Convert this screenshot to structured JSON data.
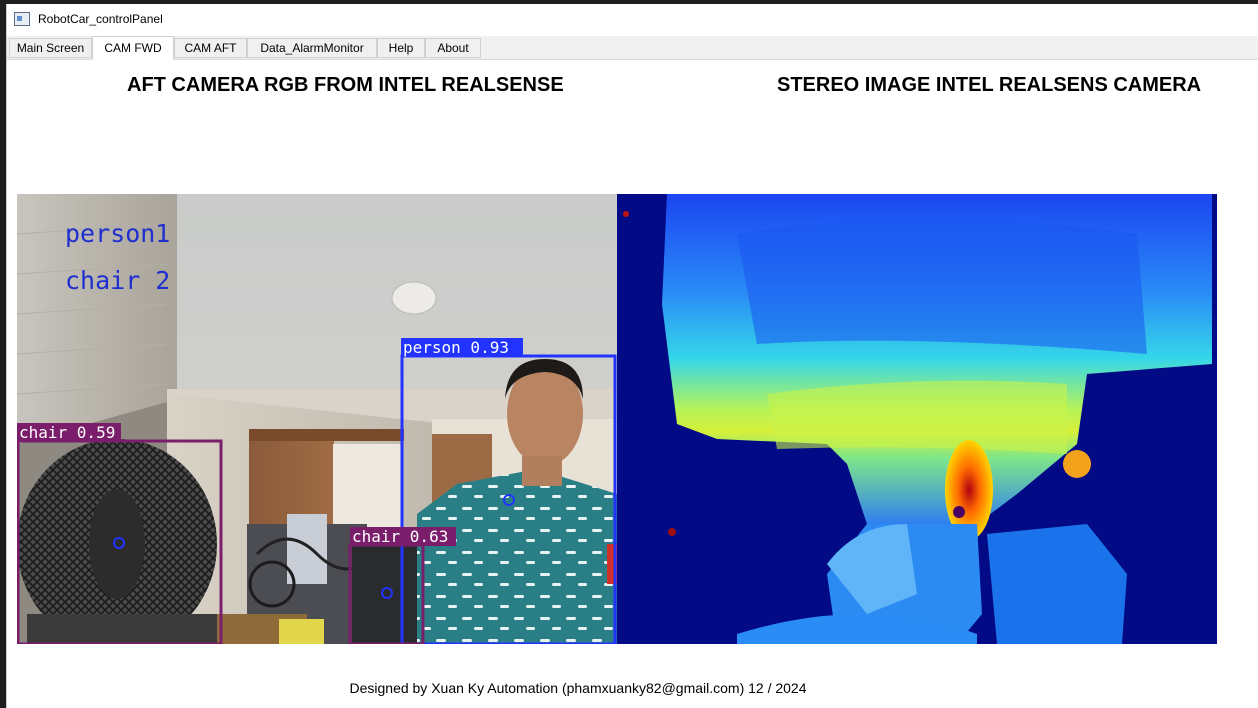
{
  "window": {
    "title": "RobotCar_controlPanel",
    "icon": "app-window-icon"
  },
  "tabs": [
    {
      "label": "Main Screen",
      "active": false
    },
    {
      "label": "CAM FWD",
      "active": true
    },
    {
      "label": "CAM AFT",
      "active": false
    },
    {
      "label": "Data_AlarmMonitor",
      "active": false
    },
    {
      "label": "Help",
      "active": false
    },
    {
      "label": "About",
      "active": false
    }
  ],
  "main": {
    "left_heading": "AFT CAMERA  RGB FROM INTEL REALSENSE",
    "right_heading": "STEREO IMAGE INTEL REALSENS CAMERA",
    "rgb_view": {
      "counters": [
        "person1",
        "chair  2"
      ],
      "detections": [
        {
          "label": "person 0.93",
          "color": "#2233ff"
        },
        {
          "label": "chair 0.59",
          "color": "#7a1d6a"
        },
        {
          "label": "chair 0.63",
          "color": "#7a1d6a"
        }
      ]
    }
  },
  "footer": "Designed by Xuan Ky Automation (phamxuanky82@gmail.com) 12 / 2024"
}
